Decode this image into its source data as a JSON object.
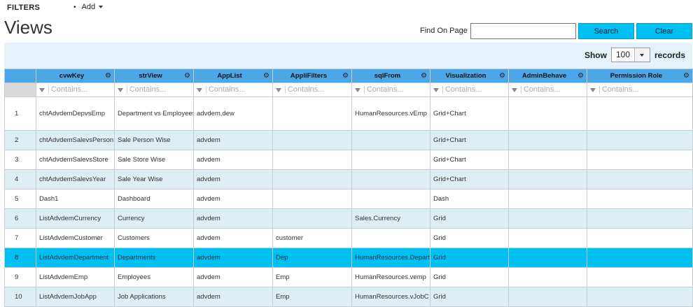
{
  "topbar": {
    "filters_label": "FILTERS",
    "add_label": "Add"
  },
  "page": {
    "title": "Views"
  },
  "search": {
    "label": "Find On Page",
    "value": "",
    "search_button": "Search",
    "clear_button": "Clear"
  },
  "paging": {
    "show_label": "Show",
    "page_size": "100",
    "records_label": "records"
  },
  "colors": {
    "header_bg": "#4aa8e8",
    "button_bg": "#00bff3",
    "selected_row": "#00bff3",
    "alt_row": "#ddeef4",
    "panel_bg": "#e6f1fb"
  },
  "grid": {
    "filter_placeholder": "Contains...",
    "columns": [
      "cvwKey",
      "strView",
      "AppList",
      "AppliFilters",
      "sqlFrom",
      "Visualization",
      "AdminBehave",
      "Permission Role"
    ],
    "rows": [
      {
        "num": "1",
        "cells": [
          "chtAdvdemDepvsEmp",
          "Department vs Employees",
          "advdem,dew",
          "",
          "HumanResources.vEmp",
          "Grid+Chart",
          "",
          ""
        ]
      },
      {
        "num": "2",
        "cells": [
          "chtAdvdemSalevsPerson",
          "Sale Person Wise",
          "advdem",
          "",
          "",
          "Grid+Chart",
          "",
          ""
        ]
      },
      {
        "num": "3",
        "cells": [
          "chtAdvdemSalevsStore",
          "Sale Store Wise",
          "advdem",
          "",
          "",
          "Grid+Chart",
          "",
          ""
        ]
      },
      {
        "num": "4",
        "cells": [
          "chtAdvdemSalevsYear",
          "Sale Year Wise",
          "advdem",
          "",
          "",
          "Grid+Chart",
          "",
          ""
        ]
      },
      {
        "num": "5",
        "cells": [
          "Dash1",
          "Dashboard",
          "advdem",
          "",
          "",
          "Dash",
          "",
          ""
        ]
      },
      {
        "num": "6",
        "cells": [
          "ListAdvdemCurrency",
          "Currency",
          "advdem",
          "",
          "Sales.Currency",
          "Grid",
          "",
          ""
        ]
      },
      {
        "num": "7",
        "cells": [
          "ListAdvdemCustomer",
          "Customers",
          "advdem",
          "customer",
          "",
          "Grid",
          "",
          ""
        ]
      },
      {
        "num": "8",
        "cells": [
          "ListAdvdemDepartment",
          "Departments",
          "advdem",
          "Dep",
          "HumanResources.Department",
          "Grid",
          "",
          ""
        ]
      },
      {
        "num": "9",
        "cells": [
          "ListAdvdemEmp",
          "Employees",
          "advdem",
          "Emp",
          "HumanResources.vemp",
          "Grid",
          "",
          ""
        ]
      },
      {
        "num": "10",
        "cells": [
          "ListAdvdemJobApp",
          "Job Applications",
          "advdem",
          "Emp",
          "HumanResources.vJobC",
          "Grid",
          "",
          ""
        ]
      }
    ]
  }
}
